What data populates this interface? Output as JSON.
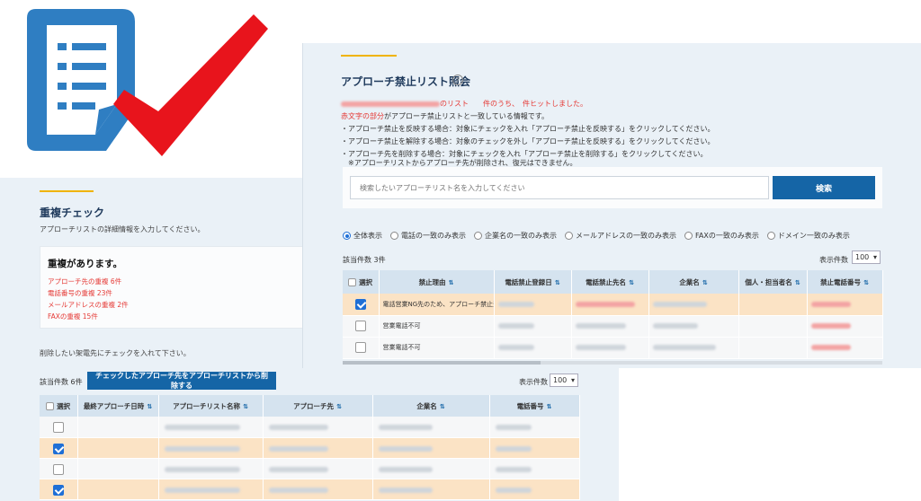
{
  "colors": {
    "accent_blue": "#1565a6",
    "highlight_row": "#fbe3c5",
    "warning_red": "#e53935",
    "panel_bg": "#eaf1f7",
    "checkmark_red": "#e8141c"
  },
  "icons": {
    "logo": "document-list-icon",
    "check": "red-checkmark-icon"
  },
  "dup_check": {
    "title": "重複チェック",
    "description": "アプローチリストの詳細情報を入力してください。",
    "box_title": "重複があります。",
    "items": [
      "アプローチ先の重複 6件",
      "電話番号の重複 23件",
      "メールアドレスの重複 2件",
      "FAXの重複 15件"
    ],
    "hint": "削除したい架電先にチェックを入れて下さい。",
    "count": "該当件数 6件",
    "delete_button": "チェックしたアプローチ先をアプローチリストから削除する",
    "per_page_label": "表示件数",
    "per_page_value": "100",
    "columns": [
      "選択",
      "最終アプローチ日時",
      "アプローチリスト名称",
      "アプローチ先",
      "企業名",
      "電話番号"
    ],
    "rows": [
      {
        "checked": false,
        "highlight": false
      },
      {
        "checked": true,
        "highlight": true
      },
      {
        "checked": false,
        "highlight": false
      },
      {
        "checked": true,
        "highlight": true
      }
    ]
  },
  "ban_list": {
    "title": "アプローチ禁止リスト照会",
    "result_text": "のリスト　　件のうち、　件ヒットしました。",
    "red_note": "赤文字の部分",
    "note_rest": "がアプローチ禁止リストと一致している情報です。",
    "instructions": [
      "・アプローチ禁止を反映する場合：対象にチェックを入れ「アプローチ禁止を反映する」をクリックしてください。",
      "・アプローチ禁止を解除する場合：対象のチェックを外し「アプローチ禁止を反映する」をクリックしてください。",
      "・アプローチ先を削除する場合：対象にチェックを入れ「アプローチ禁止を削除する」をクリックしてください。",
      "　※アプローチリストからアプローチ先が削除され、復元はできません。"
    ],
    "search_placeholder": "検索したいアプローチリスト名を入力してください",
    "search_button": "検索",
    "filters": [
      "全体表示",
      "電話の一致のみ表示",
      "企業名の一致のみ表示",
      "メールアドレスの一致のみ表示",
      "FAXの一致のみ表示",
      "ドメイン一致のみ表示"
    ],
    "selected_filter": "全体表示",
    "count": "該当件数 3件",
    "per_page_label": "表示件数",
    "per_page_value": "100",
    "columns": [
      "選択",
      "禁止理由",
      "電話禁止登録日",
      "電話禁止先名",
      "企業名",
      "個人・担当者名",
      "禁止電話番号"
    ],
    "rows": [
      {
        "checked": true,
        "highlight": true,
        "reason": "電話営業NG先のため、アプローチ禁止登録"
      },
      {
        "checked": false,
        "highlight": false,
        "reason": "営業電話不可"
      },
      {
        "checked": false,
        "highlight": false,
        "reason": "営業電話不可"
      }
    ]
  }
}
